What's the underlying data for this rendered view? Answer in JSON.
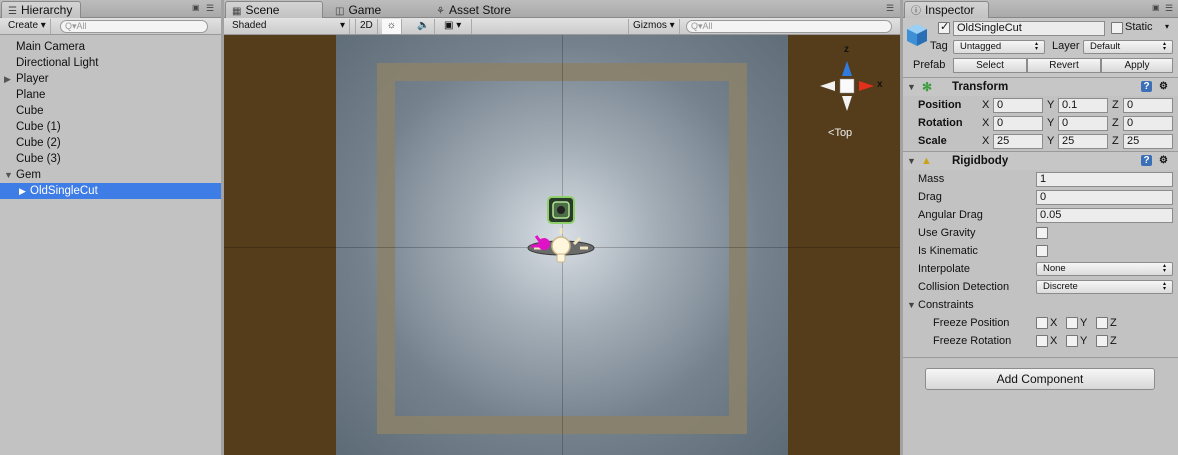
{
  "hierarchy": {
    "tab": "Hierarchy",
    "create": "Create",
    "search_placeholder": "Q▾All",
    "items": [
      "Main Camera",
      "Directional Light",
      "Player",
      "Plane",
      "Cube",
      "Cube (1)",
      "Cube (2)",
      "Cube (3)",
      "Gem",
      "OldSingleCut"
    ]
  },
  "scene": {
    "tabs": {
      "scene": "Scene",
      "game": "Game",
      "store": "Asset Store"
    },
    "shading": "Shaded",
    "mode2d": "2D",
    "gizmos": "Gizmos",
    "search_placeholder": "Q▾All",
    "view_label": "Top",
    "axis_x": "x",
    "axis_z": "z"
  },
  "inspector": {
    "tab": "Inspector",
    "name": "OldSingleCut",
    "static": "Static",
    "tag_label": "Tag",
    "tag": "Untagged",
    "layer_label": "Layer",
    "layer": "Default",
    "prefab_label": "Prefab",
    "select": "Select",
    "revert": "Revert",
    "apply": "Apply",
    "transform": {
      "title": "Transform",
      "position_label": "Position",
      "position": {
        "x": "0",
        "y": "0.1",
        "z": "0"
      },
      "rotation_label": "Rotation",
      "rotation": {
        "x": "0",
        "y": "0",
        "z": "0"
      },
      "scale_label": "Scale",
      "scale": {
        "x": "25",
        "y": "25",
        "z": "25"
      },
      "axes": {
        "x": "X",
        "y": "Y",
        "z": "Z"
      }
    },
    "rigidbody": {
      "title": "Rigidbody",
      "mass_label": "Mass",
      "mass": "1",
      "drag_label": "Drag",
      "drag": "0",
      "angular_label": "Angular Drag",
      "angular": "0.05",
      "gravity_label": "Use Gravity",
      "kinematic_label": "Is Kinematic",
      "interp_label": "Interpolate",
      "interp": "None",
      "collision_label": "Collision Detection",
      "collision": "Discrete",
      "constraints_label": "Constraints",
      "freeze_pos_label": "Freeze Position",
      "freeze_rot_label": "Freeze Rotation"
    },
    "add_component": "Add Component"
  },
  "colors": {
    "selection": "#3e7ce6",
    "floor_border": "#553d1c",
    "x_axis": "#e2301b",
    "z_axis": "#2f7bde"
  }
}
